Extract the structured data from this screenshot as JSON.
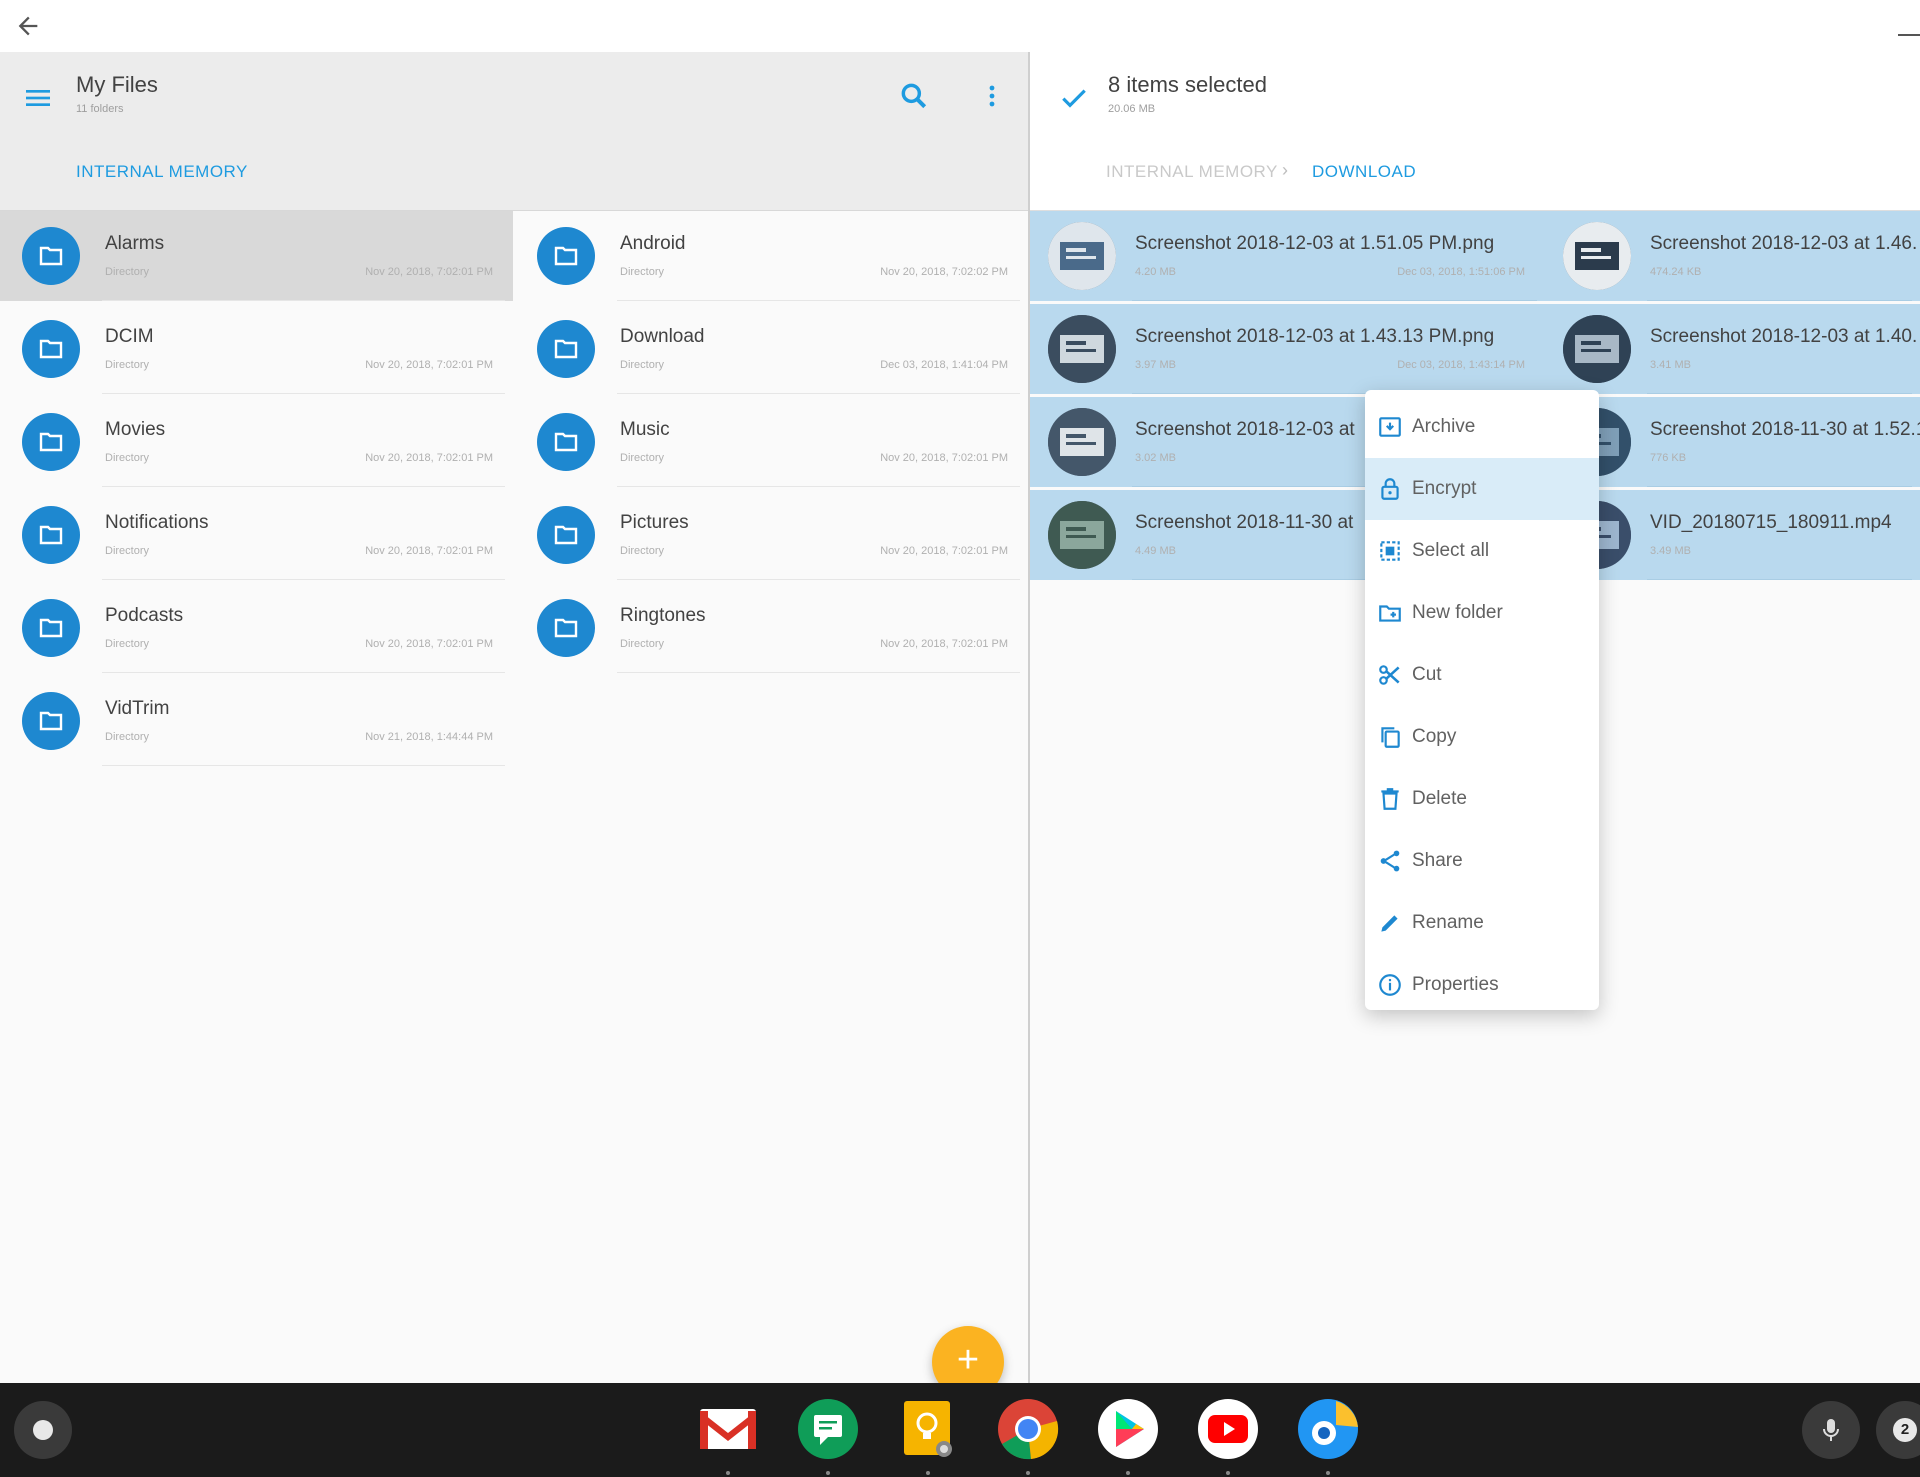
{
  "left_pane": {
    "title": "My Files",
    "subtitle": "11 folders",
    "breadcrumb": [
      "INTERNAL MEMORY"
    ],
    "folders": [
      {
        "name": "Alarms",
        "type": "Directory",
        "date": "Nov 20, 2018, 7:02:01 PM"
      },
      {
        "name": "Android",
        "type": "Directory",
        "date": "Nov 20, 2018, 7:02:02 PM"
      },
      {
        "name": "DCIM",
        "type": "Directory",
        "date": "Nov 20, 2018, 7:02:01 PM"
      },
      {
        "name": "Download",
        "type": "Directory",
        "date": "Dec 03, 2018, 1:41:04 PM"
      },
      {
        "name": "Movies",
        "type": "Directory",
        "date": "Nov 20, 2018, 7:02:01 PM"
      },
      {
        "name": "Music",
        "type": "Directory",
        "date": "Nov 20, 2018, 7:02:01 PM"
      },
      {
        "name": "Notifications",
        "type": "Directory",
        "date": "Nov 20, 2018, 7:02:01 PM"
      },
      {
        "name": "Pictures",
        "type": "Directory",
        "date": "Nov 20, 2018, 7:02:01 PM"
      },
      {
        "name": "Podcasts",
        "type": "Directory",
        "date": "Nov 20, 2018, 7:02:01 PM"
      },
      {
        "name": "Ringtones",
        "type": "Directory",
        "date": "Nov 20, 2018, 7:02:01 PM"
      },
      {
        "name": "VidTrim",
        "type": "Directory",
        "date": "Nov 21, 2018, 1:44:44 PM"
      }
    ]
  },
  "right_pane": {
    "title": "8 items selected",
    "subtitle": "20.06 MB",
    "breadcrumb": [
      "INTERNAL MEMORY",
      "DOWNLOAD"
    ],
    "files": [
      {
        "name": "Screenshot 2018-12-03 at 1.51.05 PM.png",
        "size": "4.20 MB",
        "date": "Dec 03, 2018, 1:51:06 PM"
      },
      {
        "name": "Screenshot 2018-12-03 at 1.46.",
        "size": "474.24 KB",
        "date": ""
      },
      {
        "name": "Screenshot 2018-12-03 at 1.43.13 PM.png",
        "size": "3.97 MB",
        "date": "Dec 03, 2018, 1:43:14 PM"
      },
      {
        "name": "Screenshot 2018-12-03 at 1.40.",
        "size": "3.41 MB",
        "date": ""
      },
      {
        "name": "Screenshot 2018-12-03 at",
        "size": "3.02 MB",
        "date": ""
      },
      {
        "name": "Screenshot 2018-11-30 at 1.52.1",
        "size": "776 KB",
        "date": ""
      },
      {
        "name": "Screenshot 2018-11-30 at",
        "size": "4.49 MB",
        "date": ""
      },
      {
        "name": "VID_20180715_180911.mp4",
        "size": "3.49 MB",
        "date": ""
      }
    ]
  },
  "context_menu": {
    "items": [
      {
        "label": "Archive",
        "icon": "archive-icon"
      },
      {
        "label": "Encrypt",
        "icon": "lock-icon"
      },
      {
        "label": "Select all",
        "icon": "select-all-icon"
      },
      {
        "label": "New folder",
        "icon": "new-folder-icon"
      },
      {
        "label": "Cut",
        "icon": "scissors-icon"
      },
      {
        "label": "Copy",
        "icon": "copy-icon"
      },
      {
        "label": "Delete",
        "icon": "trash-icon"
      },
      {
        "label": "Share",
        "icon": "share-icon"
      },
      {
        "label": "Rename",
        "icon": "pencil-icon"
      },
      {
        "label": "Properties",
        "icon": "info-icon"
      }
    ]
  },
  "action_bar": [
    "scissors-icon",
    "copy-icon",
    "trash-icon",
    "share-icon",
    "pencil-icon",
    "duplicate-icon",
    "more-vert-icon"
  ],
  "shelf": {
    "apps": [
      "gmail-icon",
      "hangouts-chat-icon",
      "keep-icon",
      "chrome-icon",
      "play-store-icon",
      "youtube-icon",
      "files-app-icon"
    ],
    "status_number": "2"
  },
  "colors": {
    "accent": "#1e88d0",
    "selection": "#b9d9ee",
    "fab": "#fbb321",
    "shelf": "#1b1b1b"
  }
}
